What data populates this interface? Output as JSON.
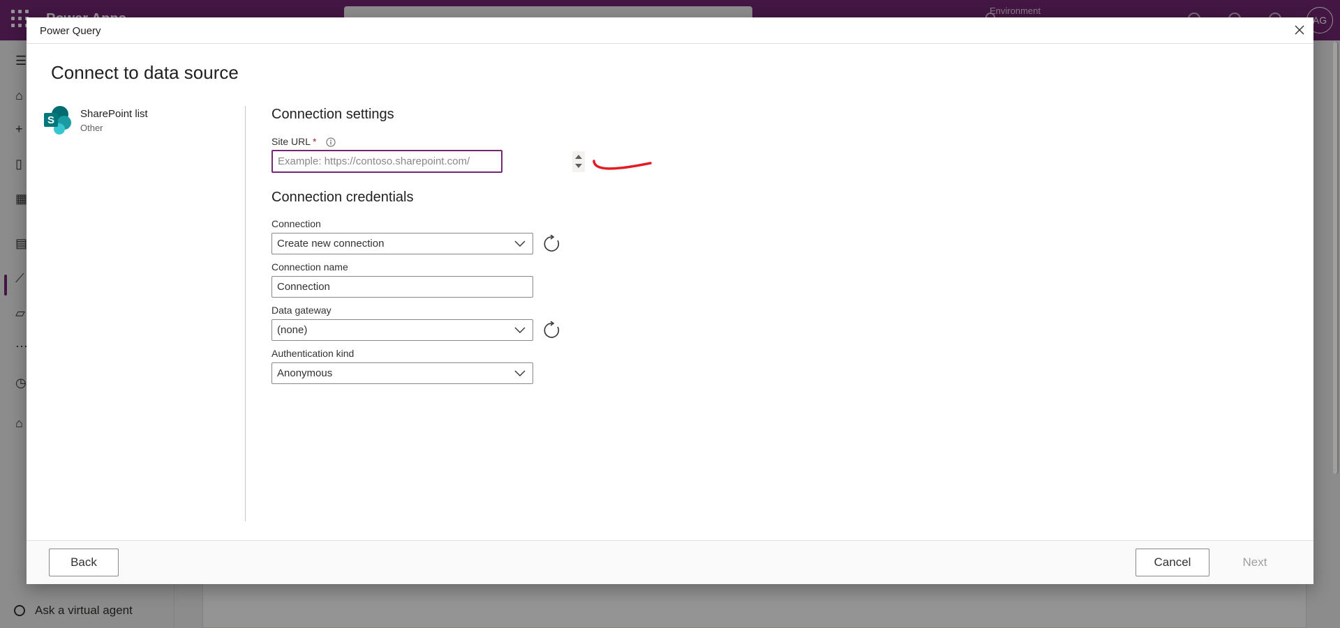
{
  "background": {
    "app_name": "Power Apps",
    "environment_label": "Environment",
    "avatar_initials": "AG",
    "ask_agent_label": "Ask a virtual agent"
  },
  "dialog": {
    "title": "Power Query",
    "page_title": "Connect to data source",
    "connector": {
      "name": "SharePoint list",
      "category": "Other"
    },
    "connection_settings": {
      "title": "Connection settings",
      "site_url_label": "Site URL",
      "required_mark": "*",
      "site_url_value": "",
      "site_url_placeholder": "Example: https://contoso.sharepoint.com/"
    },
    "connection_credentials": {
      "title": "Connection credentials",
      "connection_label": "Connection",
      "connection_value": "Create new connection",
      "connection_name_label": "Connection name",
      "connection_name_value": "Connection",
      "data_gateway_label": "Data gateway",
      "data_gateway_value": "(none)",
      "auth_kind_label": "Authentication kind",
      "auth_kind_value": "Anonymous"
    },
    "footer": {
      "back_label": "Back",
      "cancel_label": "Cancel",
      "next_label": "Next"
    }
  },
  "colors": {
    "brand": "#742774",
    "required": "#a4262c",
    "annotation": "#e31b23",
    "sharepoint_dark": "#036c70",
    "sharepoint_mid": "#1a9ba1",
    "sharepoint_light": "#37c6d0"
  },
  "icons": [
    "waffle-icon",
    "close-icon",
    "info-icon",
    "chevron-down-icon",
    "refresh-icon",
    "sharepoint-logo-icon"
  ]
}
